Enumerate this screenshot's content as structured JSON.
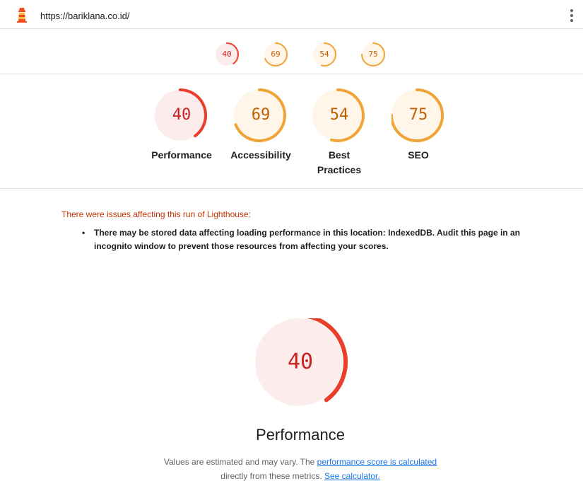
{
  "topbar": {
    "url": "https://bariklana.co.id/"
  },
  "icons": {
    "logo": "lighthouse-logo-icon",
    "menu": "kebab-menu-icon"
  },
  "colors": {
    "fail": "#e8402c",
    "fail_text": "#c7221f",
    "fail_bg": "#fdecec",
    "average": "#f0a436",
    "average_text": "#c25e00",
    "average_bg": "#fff6e9",
    "warning_text": "#c33300",
    "link": "#1a73e8"
  },
  "scores": [
    {
      "key": "performance",
      "label": "Performance",
      "score": 40,
      "rating": "fail"
    },
    {
      "key": "accessibility",
      "label": "Accessibility",
      "score": 69,
      "rating": "average"
    },
    {
      "key": "best-practices",
      "label": "Best Practices",
      "label_line1": "Best",
      "label_line2": "Practices",
      "score": 54,
      "rating": "average"
    },
    {
      "key": "seo",
      "label": "SEO",
      "score": 75,
      "rating": "average"
    }
  ],
  "warnings": {
    "title": "There were issues affecting this run of Lighthouse:",
    "items": [
      "There may be stored data affecting loading performance in this location: IndexedDB. Audit this page in an incognito window to prevent those resources from affecting your scores."
    ]
  },
  "performance_section": {
    "title": "Performance",
    "score": 40,
    "desc_prefix": "Values are estimated and may vary. The ",
    "desc_link1": "performance score is calculated",
    "desc_middle": "directly from these metrics. ",
    "desc_link2": "See calculator."
  }
}
